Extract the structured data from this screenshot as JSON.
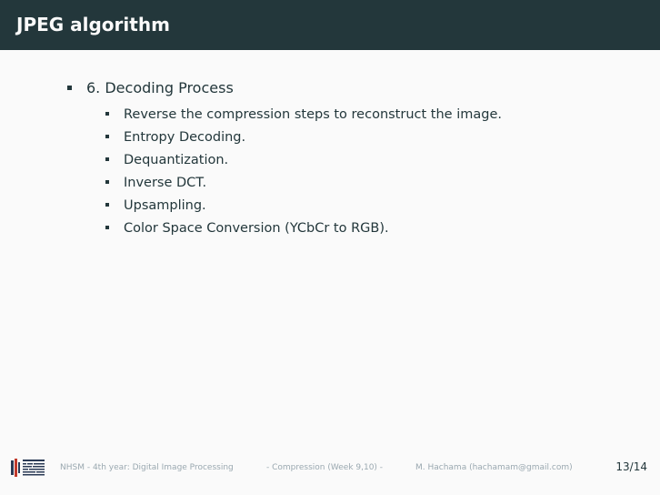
{
  "slide": {
    "title": "JPEG algorithm",
    "main_item": "6. Decoding Process",
    "sub_items": [
      "Reverse the compression steps to reconstruct the image.",
      "Entropy Decoding.",
      "Dequantization.",
      "Inverse DCT.",
      "Upsampling.",
      "Color Space Conversion (YCbCr to RGB)."
    ]
  },
  "footer": {
    "course": "NHSM - 4th year: Digital Image Processing",
    "section": "- Compression (Week 9,10) -",
    "author": "M. Hachama (hachamam@gmail.com)",
    "page": "13/14"
  },
  "colors": {
    "titlebar": "#23373b",
    "background": "#fafafa",
    "footer_text": "#9aa8b0"
  },
  "icons": {
    "logo": "nhsm-logo-icon"
  }
}
